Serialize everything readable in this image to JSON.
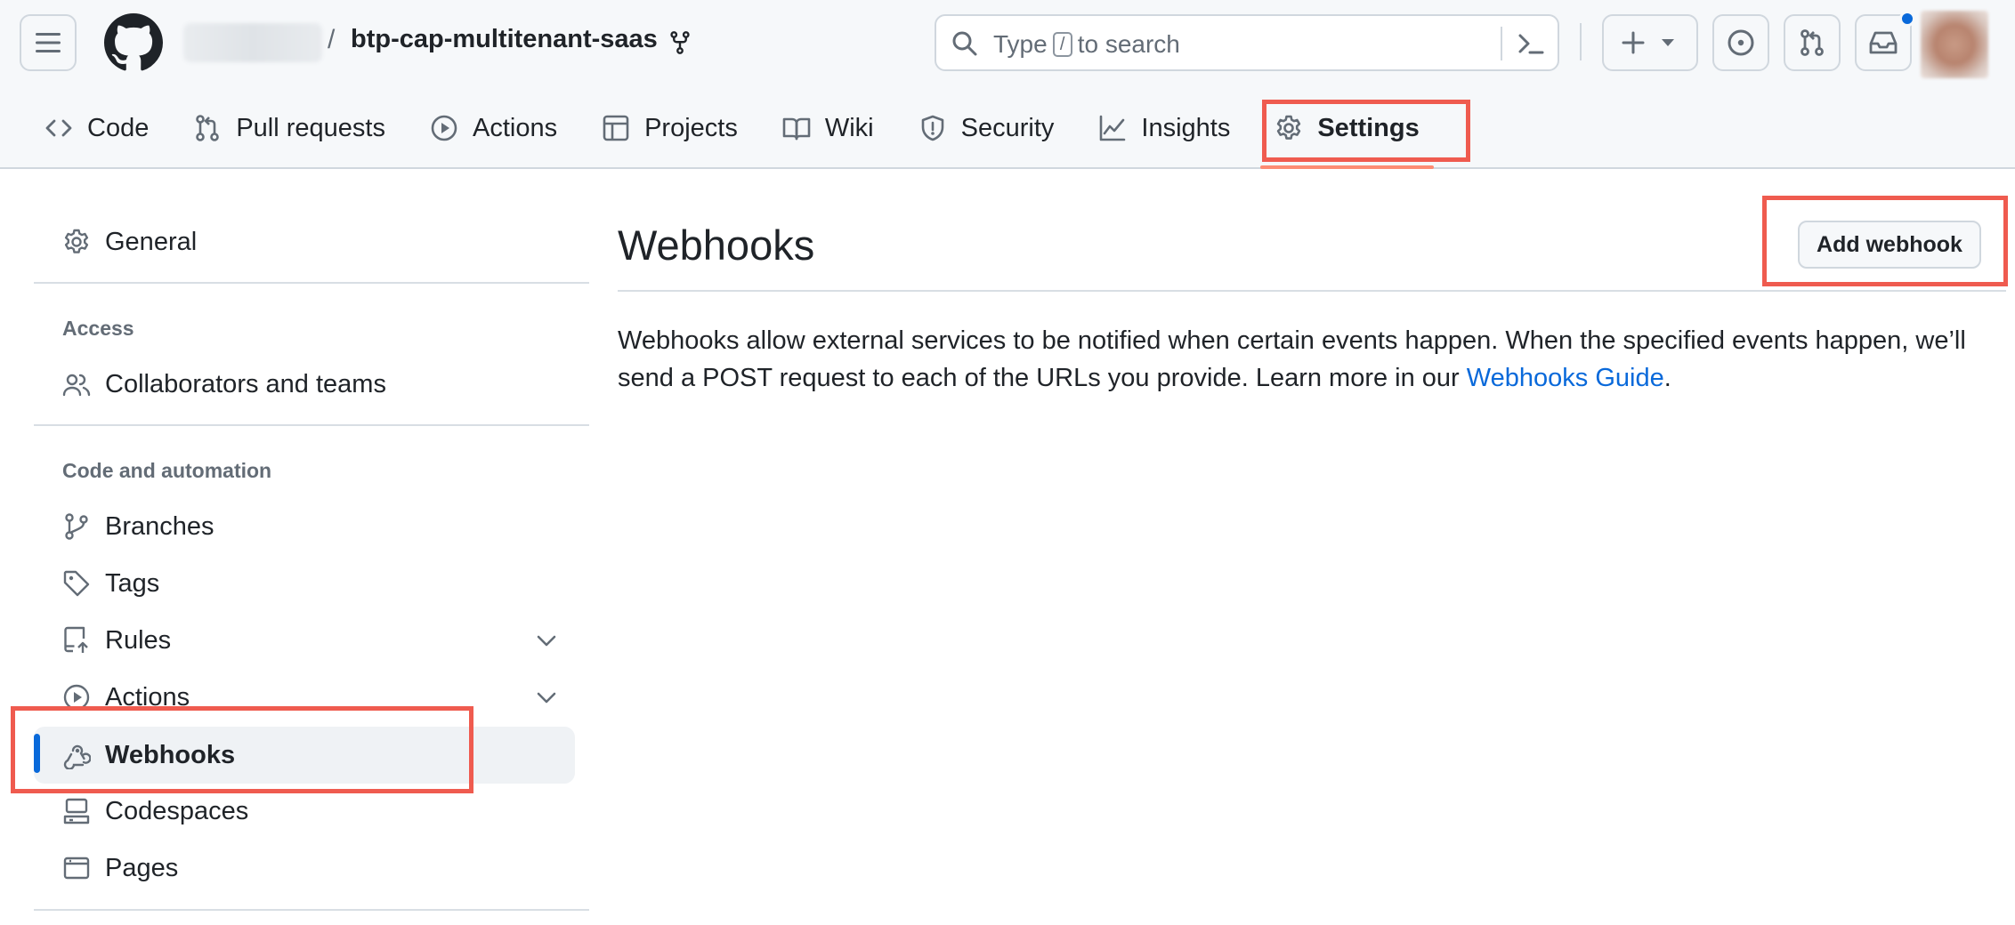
{
  "header": {
    "repo_owner_hidden": true,
    "separator": "/",
    "repo_name": "btp-cap-multitenant-saas",
    "search": {
      "prefix": "Type",
      "shortcut_key": "/",
      "suffix": "to search"
    },
    "notification_dot_color": "#0969da"
  },
  "tabs": [
    {
      "label": "Code",
      "icon": "code-icon"
    },
    {
      "label": "Pull requests",
      "icon": "pull-request-icon"
    },
    {
      "label": "Actions",
      "icon": "play-circle-icon"
    },
    {
      "label": "Projects",
      "icon": "table-icon"
    },
    {
      "label": "Wiki",
      "icon": "book-icon"
    },
    {
      "label": "Security",
      "icon": "shield-icon"
    },
    {
      "label": "Insights",
      "icon": "graph-icon"
    },
    {
      "label": "Settings",
      "icon": "gear-icon",
      "active": true
    }
  ],
  "sidebar": {
    "general": "General",
    "access_heading": "Access",
    "collaborators": "Collaborators and teams",
    "code_heading": "Code and automation",
    "branches": "Branches",
    "tags": "Tags",
    "rules": "Rules",
    "actions": "Actions",
    "webhooks": "Webhooks",
    "codespaces": "Codespaces",
    "pages": "Pages",
    "selected": "Webhooks"
  },
  "main": {
    "title": "Webhooks",
    "add_button": "Add webhook",
    "description_part1": "Webhooks allow external services to be notified when certain events happen. When the specified events happen, we’ll send a POST request to each of the URLs you provide. Learn more in our ",
    "description_link": "Webhooks Guide",
    "description_end": "."
  },
  "colors": {
    "accent_link": "#0969da",
    "highlight_box": "#ef5b4f",
    "active_tab_underline": "#fd8c73"
  }
}
